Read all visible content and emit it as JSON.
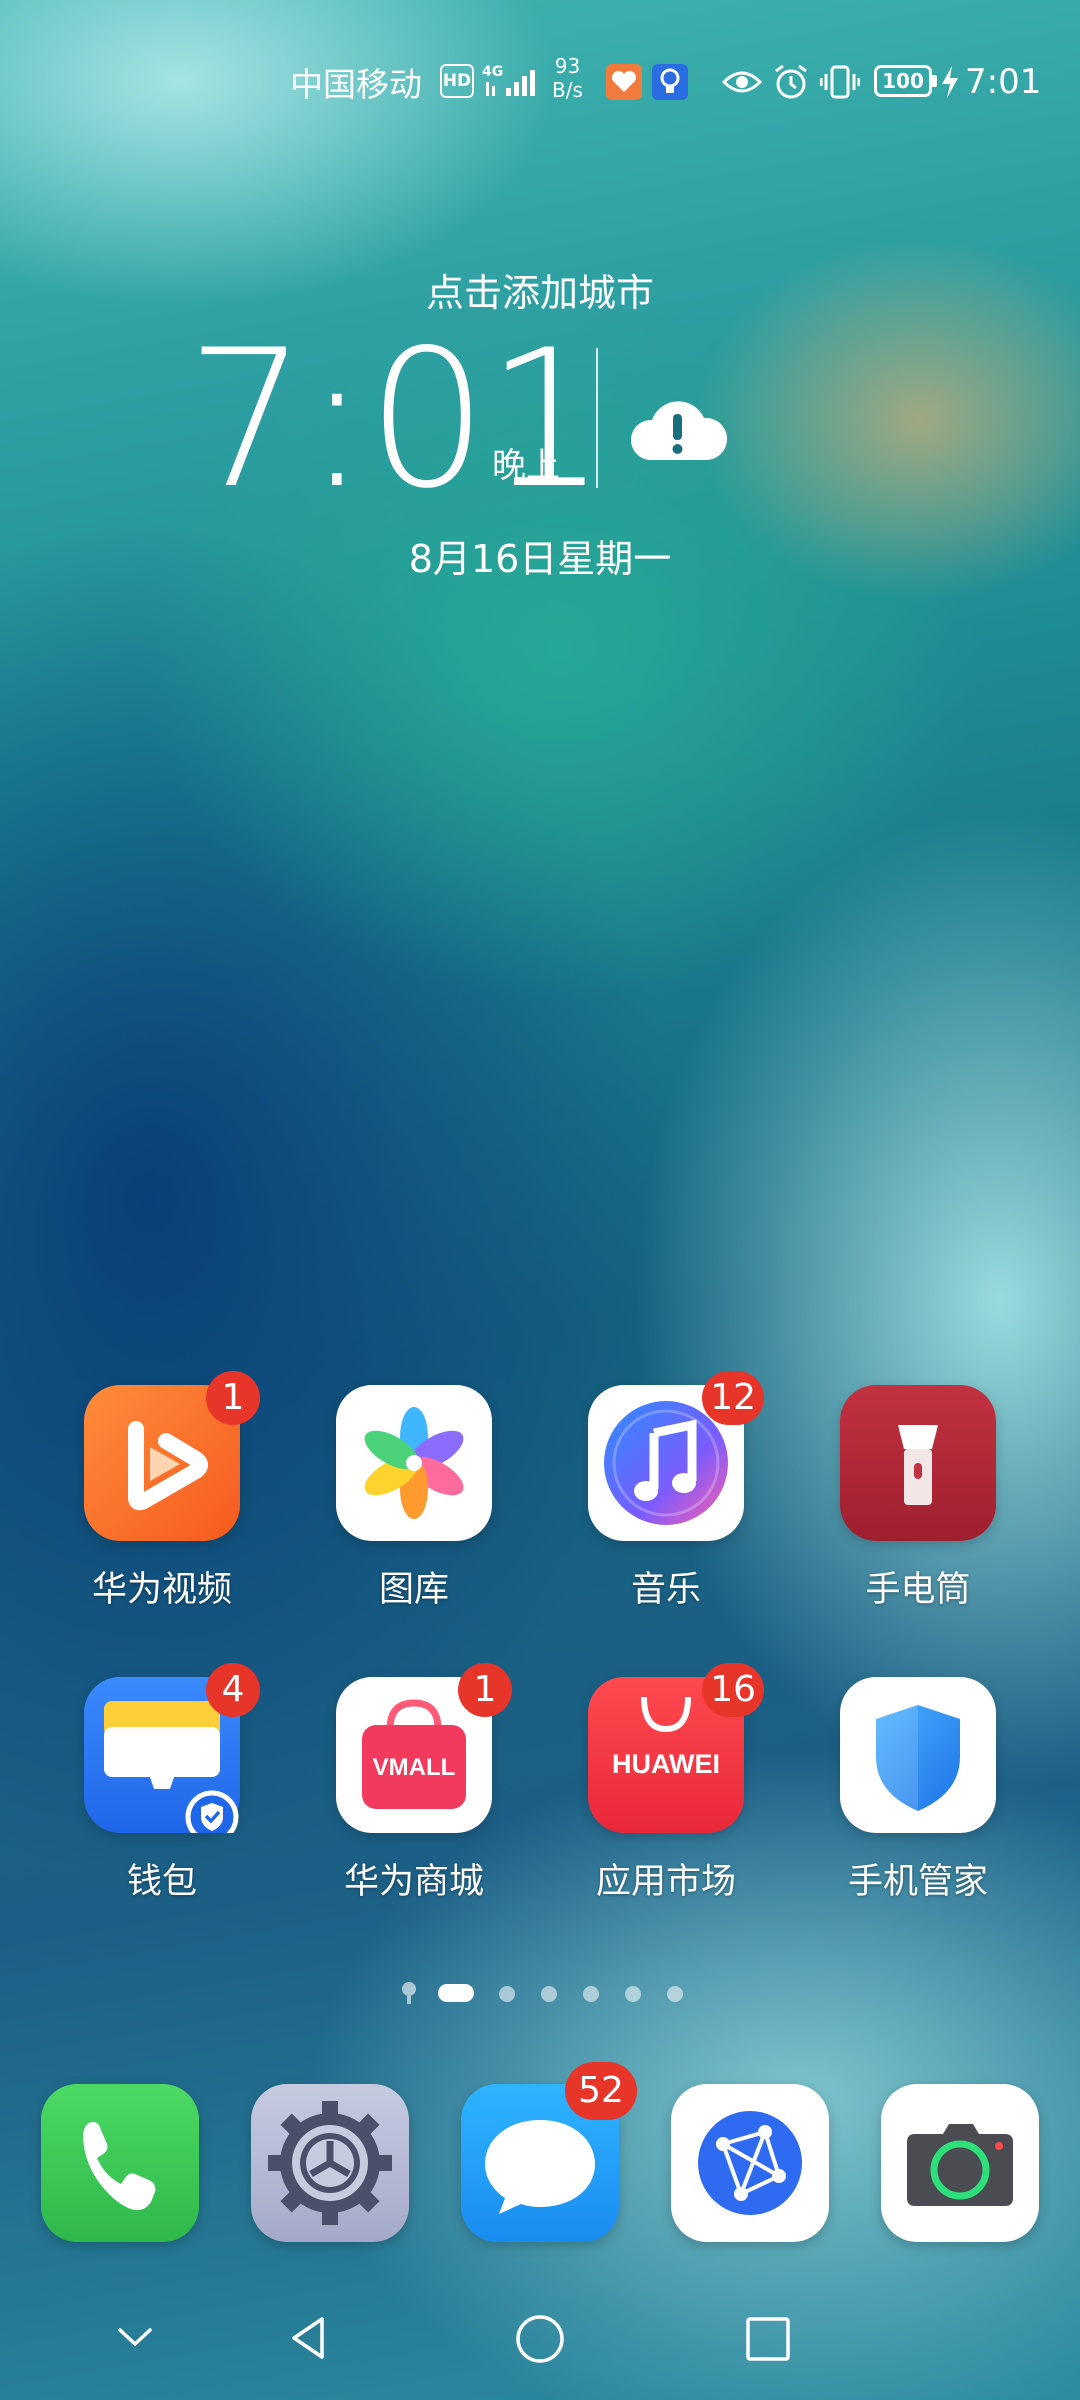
{
  "status_bar": {
    "carrier": "中国移动",
    "hd": "HD",
    "network": "4G",
    "speed_value": "93",
    "speed_unit": "B/s",
    "battery": "100",
    "time": "7:01"
  },
  "clock_widget": {
    "add_city": "点击添加城市",
    "time": "7:01",
    "ampm": "晚上",
    "date": "8月16日星期一"
  },
  "apps": [
    {
      "label": "华为视频",
      "badge": "1",
      "icon": "huawei-video-icon"
    },
    {
      "label": "图库",
      "badge": "",
      "icon": "gallery-icon"
    },
    {
      "label": "音乐",
      "badge": "12",
      "icon": "music-icon"
    },
    {
      "label": "手电筒",
      "badge": "",
      "icon": "flashlight-icon"
    },
    {
      "label": "钱包",
      "badge": "4",
      "icon": "wallet-icon"
    },
    {
      "label": "华为商城",
      "badge": "1",
      "icon": "vmall-icon",
      "icon_text": "VMALL"
    },
    {
      "label": "应用市场",
      "badge": "16",
      "icon": "app-gallery-icon",
      "icon_text": "HUAWEI"
    },
    {
      "label": "手机管家",
      "badge": "",
      "icon": "phone-manager-icon"
    }
  ],
  "dock": [
    {
      "icon": "phone-icon",
      "badge": ""
    },
    {
      "icon": "settings-icon",
      "badge": ""
    },
    {
      "icon": "messages-icon",
      "badge": "52"
    },
    {
      "icon": "browser-icon",
      "badge": ""
    },
    {
      "icon": "camera-icon",
      "badge": ""
    }
  ],
  "pager": {
    "pages": 6,
    "current": 1
  },
  "nav_bar": [
    "collapse-icon",
    "back-icon",
    "home-icon",
    "recents-icon"
  ]
}
